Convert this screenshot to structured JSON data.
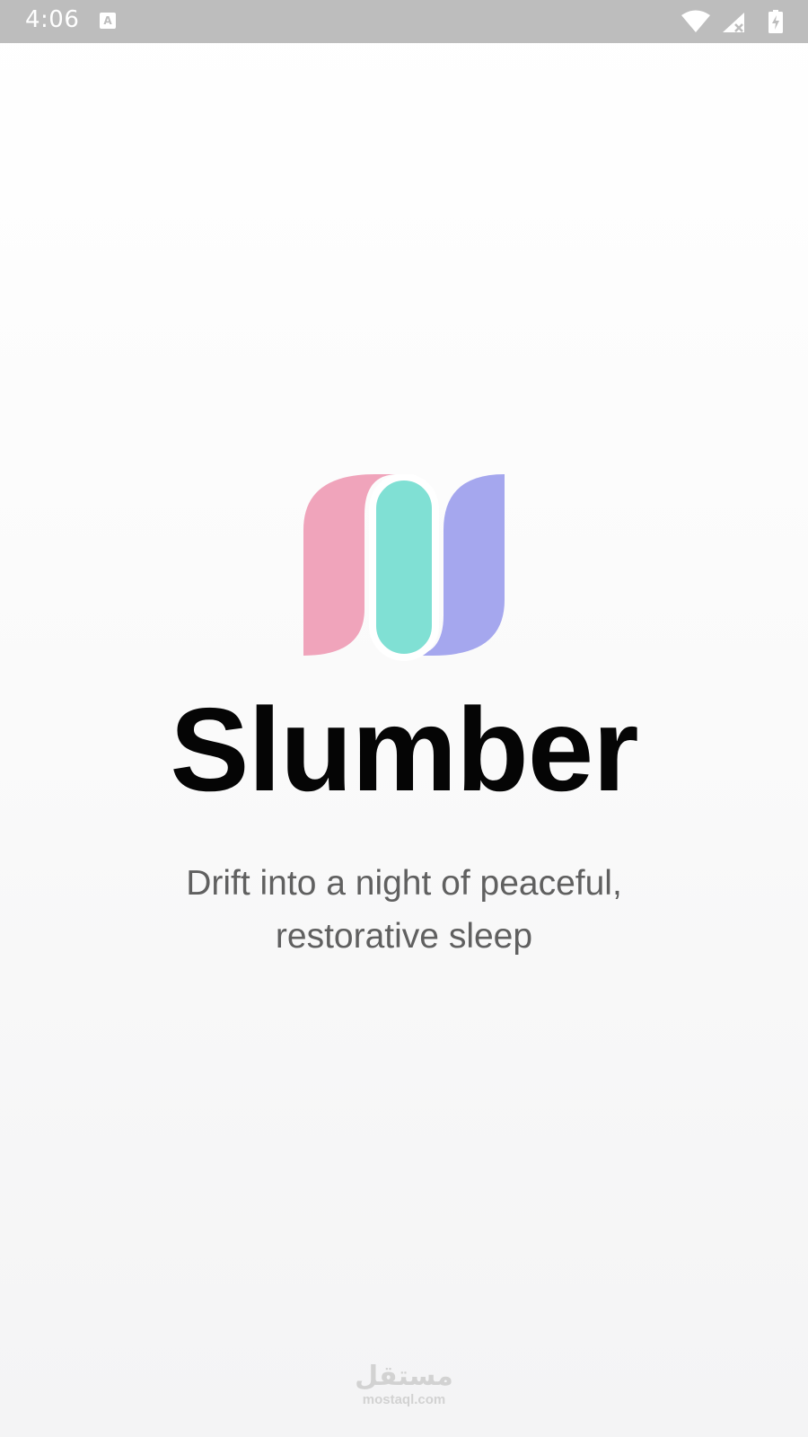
{
  "status_bar": {
    "time": "4:06",
    "icons": [
      "notification-a-icon",
      "wifi-icon",
      "signal-icon",
      "battery-icon"
    ],
    "background": "#bdbdbd"
  },
  "splash": {
    "logo": {
      "icon": "slumber-logo",
      "colors": {
        "pink": "#f0a4bb",
        "teal": "#80e0d4",
        "purple": "#a5a7ee"
      }
    },
    "title": "Slumber",
    "tagline_line1": "Drift into a night of peaceful,",
    "tagline_line2": "restorative sleep"
  },
  "watermark": {
    "arabic": "مستقل",
    "domain": "mostaql.com"
  }
}
